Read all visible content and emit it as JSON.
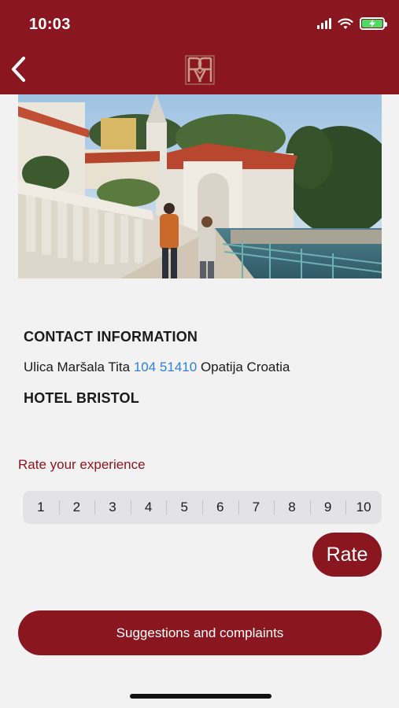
{
  "status_bar": {
    "time": "10:03"
  },
  "header": {
    "logo_name": "hotel-monogram-logo"
  },
  "contact": {
    "title": "CONTACT INFORMATION",
    "address_prefix": "Ulica Maršala Tita",
    "phone": "104 51410",
    "address_suffix": "Opatija Croatia",
    "hotel_name": "HOTEL BRISTOL"
  },
  "rating": {
    "label": "Rate your experience",
    "options": [
      "1",
      "2",
      "3",
      "4",
      "5",
      "6",
      "7",
      "8",
      "9",
      "10"
    ],
    "button_label": "Rate"
  },
  "suggestions": {
    "button_label": "Suggestions and complaints"
  },
  "colors": {
    "brand": "#8a1620",
    "link": "#2f80d6",
    "background": "#f2f2f2"
  }
}
